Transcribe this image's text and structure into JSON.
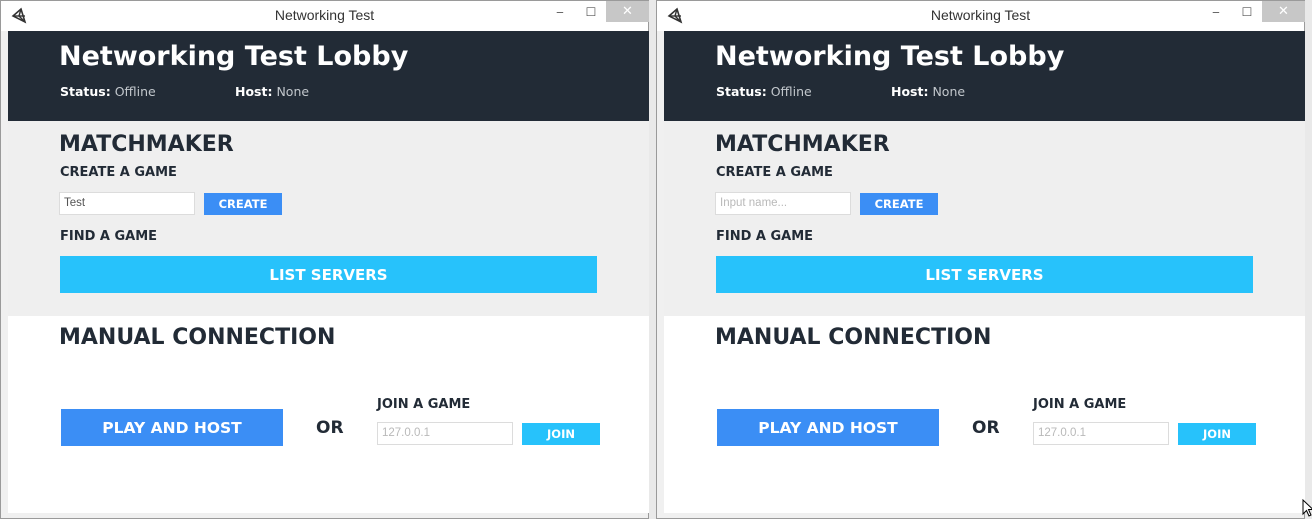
{
  "windows": [
    {
      "title": "Networking Test",
      "lobby_title": "Networking Test Lobby",
      "status_label": "Status:",
      "status_value": "Offline",
      "host_label": "Host:",
      "host_value": "None",
      "matchmaker_heading": "MATCHMAKER",
      "create_heading": "CREATE A GAME",
      "name_input_value": "Test",
      "name_input_placeholder": "",
      "create_button": "CREATE",
      "find_heading": "FIND A GAME",
      "list_servers_button": "LIST SERVERS",
      "manual_heading": "MANUAL CONNECTION",
      "play_host_button": "PLAY AND HOST",
      "or_text": "OR",
      "join_heading": "JOIN A GAME",
      "ip_input_value": "127.0.0.1",
      "join_button": "JOIN"
    },
    {
      "title": "Networking Test",
      "lobby_title": "Networking Test Lobby",
      "status_label": "Status:",
      "status_value": "Offline",
      "host_label": "Host:",
      "host_value": "None",
      "matchmaker_heading": "MATCHMAKER",
      "create_heading": "CREATE A GAME",
      "name_input_value": "",
      "name_input_placeholder": "Input name...",
      "create_button": "CREATE",
      "find_heading": "FIND A GAME",
      "list_servers_button": "LIST SERVERS",
      "manual_heading": "MANUAL CONNECTION",
      "play_host_button": "PLAY AND HOST",
      "or_text": "OR",
      "join_heading": "JOIN A GAME",
      "ip_input_value": "127.0.0.1",
      "join_button": "JOIN"
    }
  ],
  "window_controls": {
    "minimize": "‒",
    "maximize": "☐",
    "close": "✕"
  },
  "icons": {
    "app": "unity-logo-icon",
    "cursor": "mouse-pointer-icon"
  },
  "colors": {
    "header_bg": "#222b36",
    "primary_button": "#3b8ef5",
    "secondary_button": "#27c2fb",
    "matchmaker_bg": "#efefef"
  }
}
